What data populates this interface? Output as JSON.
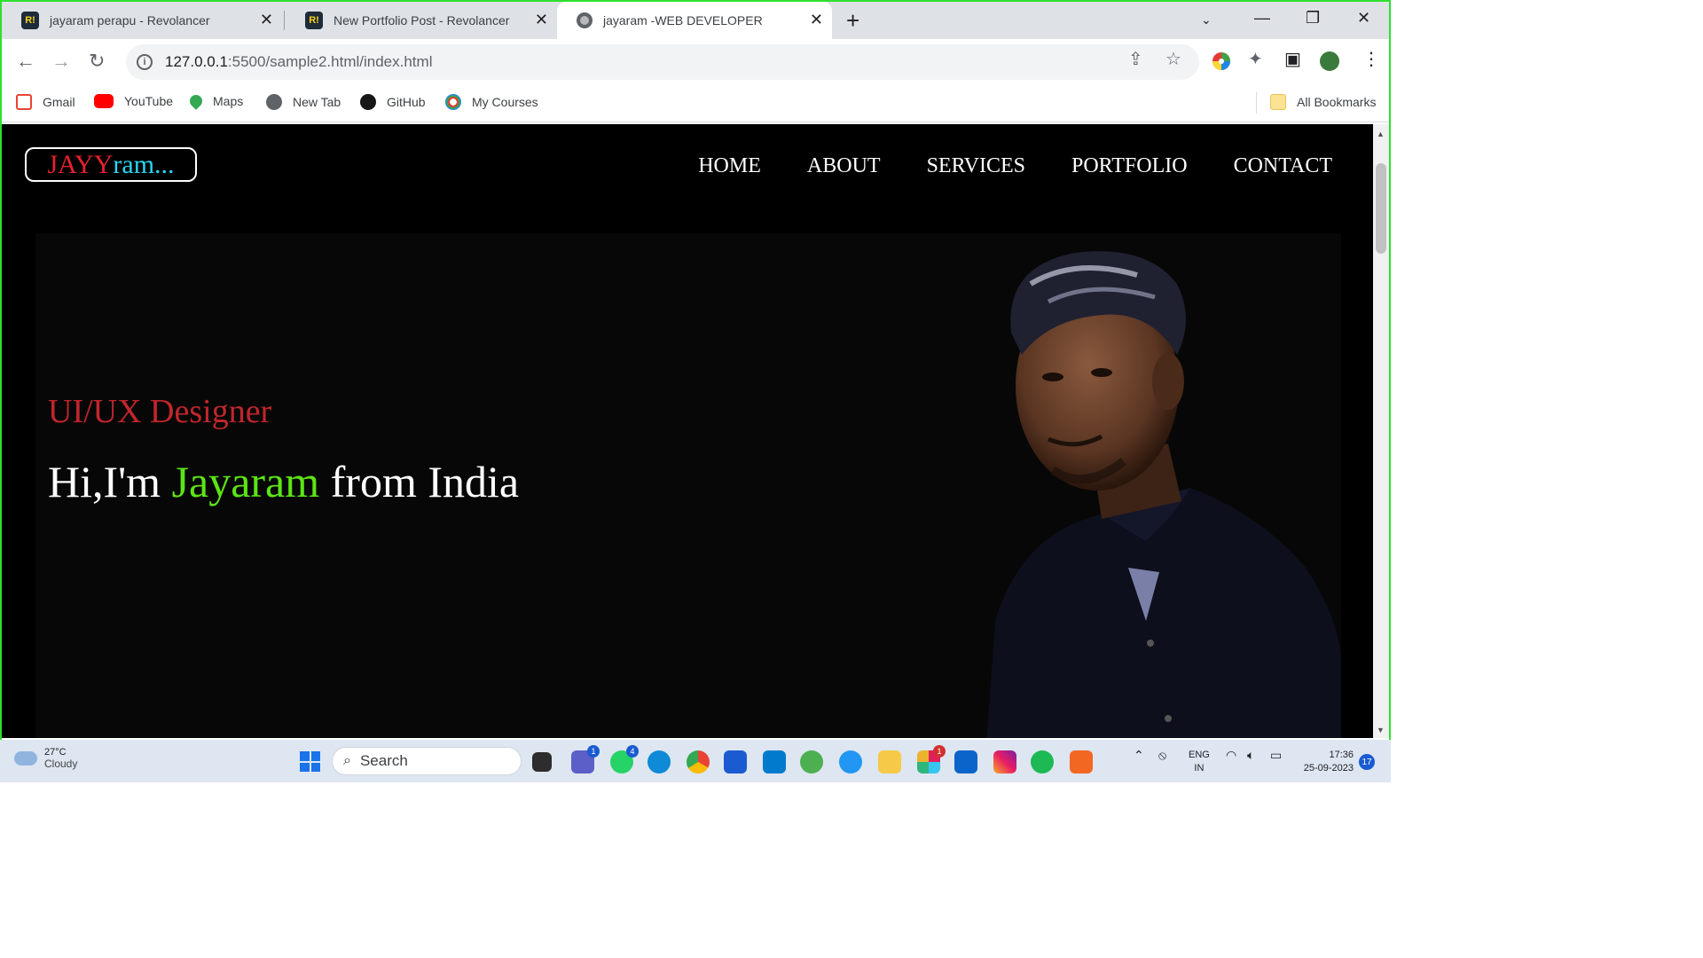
{
  "browser": {
    "tabs": [
      {
        "title": "jayaram perapu - Revolancer",
        "favicon": "R!"
      },
      {
        "title": "New Portfolio Post - Revolancer",
        "favicon": "R!"
      },
      {
        "title": "jayaram -WEB DEVELOPER",
        "favicon": "globe-icon"
      }
    ],
    "url_host": "127.0.0.1",
    "url_rest": ":5500/sample2.html/index.html",
    "bookmarks": [
      "Gmail",
      "YouTube",
      "Maps",
      "New Tab",
      "GitHub",
      "My Courses"
    ],
    "all_bookmarks": "All Bookmarks"
  },
  "site": {
    "logo_part1": "JAYY",
    "logo_part2": "ram...",
    "nav": [
      "HOME",
      "ABOUT",
      "SERVICES",
      "PORTFOLIO",
      "CONTACT"
    ],
    "subtitle": "UI/UX Designer",
    "headline_pre": "Hi,I'm ",
    "headline_name": "Jayaram",
    "headline_post": " from India",
    "colors": {
      "logo_red": "#e8212f",
      "logo_cyan": "#28d6f0",
      "subtitle": "#c0262c",
      "name_green": "#5ce414"
    }
  },
  "taskbar": {
    "temperature": "27°C",
    "condition": "Cloudy",
    "search": "Search",
    "badges": {
      "teams": "1",
      "whatsapp": "4",
      "slack": "1"
    },
    "lang": "ENG",
    "region": "IN",
    "time": "17:36",
    "date": "25-09-2023",
    "notifications": "17"
  }
}
